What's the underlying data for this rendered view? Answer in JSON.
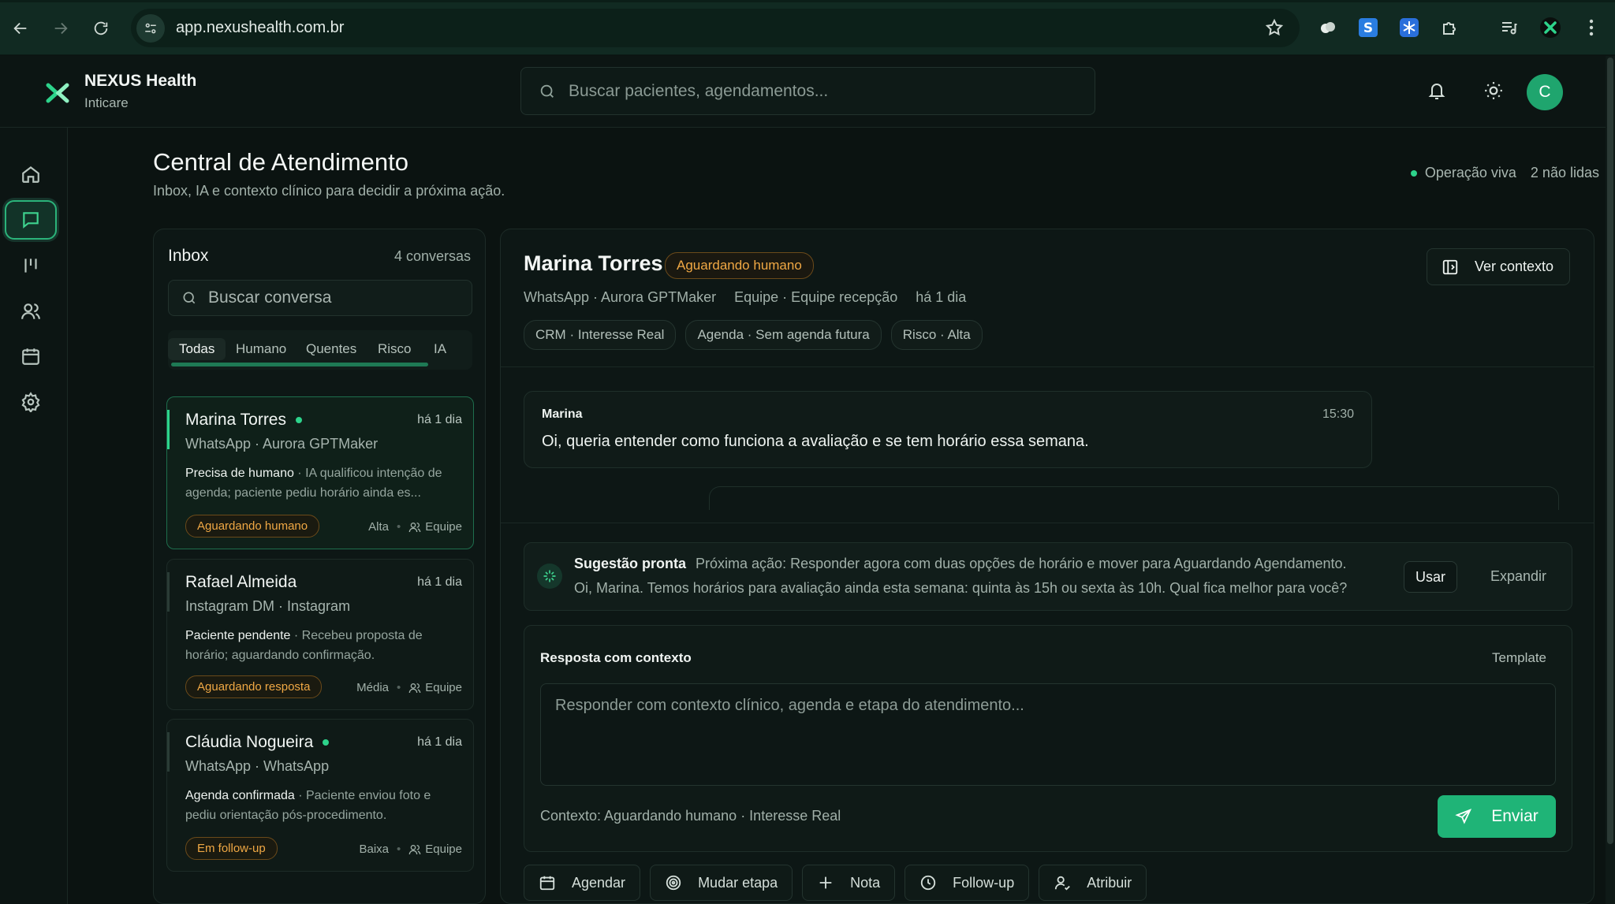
{
  "browser": {
    "url": "app.nexushealth.com.br"
  },
  "brand": {
    "name": "NEXUS Health",
    "subtitle": "Inticare",
    "accent": "#2dd38b"
  },
  "header": {
    "search_placeholder": "Buscar pacientes, agendamentos...",
    "avatar_initial": "C"
  },
  "sidebar": {
    "items": [
      {
        "icon": "home-icon"
      },
      {
        "icon": "chat-icon",
        "active": true
      },
      {
        "icon": "pipeline-icon"
      },
      {
        "icon": "users-icon"
      },
      {
        "icon": "calendar-icon"
      },
      {
        "icon": "settings-icon"
      }
    ]
  },
  "page": {
    "title": "Central de Atendimento",
    "subtitle": "Inbox, IA e contexto clínico para decidir a próxima ação.",
    "live_status": "Operação viva",
    "unread": "2 não lidas"
  },
  "inbox": {
    "title": "Inbox",
    "count": "4 conversas",
    "search_placeholder": "Buscar conversa",
    "filters": [
      "Todas",
      "Humano",
      "Quentes",
      "Risco",
      "IA"
    ],
    "active_filter": "Todas",
    "conversations": [
      {
        "name": "Marina Torres",
        "online": true,
        "time": "há 1 dia",
        "channel": "WhatsApp · Aurora GPTMaker",
        "preview_strong": "Precisa de humano",
        "preview_text": " · IA qualificou intenção de agenda; paciente pediu horário ainda es...",
        "tag": "Aguardando humano",
        "priority": "Alta",
        "team": "Equipe"
      },
      {
        "name": "Rafael Almeida",
        "online": false,
        "time": "há 1 dia",
        "channel": "Instagram DM · Instagram",
        "preview_strong": "Paciente pendente",
        "preview_text": " · Recebeu proposta de horário; aguardando confirmação.",
        "tag": "Aguardando resposta",
        "priority": "Média",
        "team": "Equipe"
      },
      {
        "name": "Cláudia Nogueira",
        "online": true,
        "time": "há 1 dia",
        "channel": "WhatsApp · WhatsApp",
        "preview_strong": "Agenda confirmada",
        "preview_text": " · Paciente enviou foto e pediu orientação pós-procedimento.",
        "tag": "Em follow-up",
        "priority": "Baixa",
        "team": "Equipe"
      }
    ]
  },
  "conversation": {
    "contact_name": "Marina Torres",
    "status": "Aguardando humano",
    "context_button": "Ver contexto",
    "meta": [
      "WhatsApp · Aurora GPTMaker",
      "Equipe · Equipe recepção",
      "há 1 dia"
    ],
    "chips": [
      "CRM · Interesse Real",
      "Agenda · Sem agenda futura",
      "Risco · Alta"
    ],
    "messages": [
      {
        "sender": "Marina",
        "time": "15:30",
        "text": "Oi, queria entender como funciona a avaliação e se tem horário essa semana."
      }
    ],
    "suggestion": {
      "title": "Sugestão pronta",
      "next_action": "Próxima ação: Responder agora com duas opções de horário e mover para Aguardando Agendamento.",
      "draft": "Oi, Marina. Temos horários para avaliação ainda esta semana: quinta às 15h ou sexta às 10h. Qual fica melhor para você?",
      "use_label": "Usar",
      "expand_label": "Expandir"
    },
    "composer": {
      "title": "Resposta com contexto",
      "template_label": "Template",
      "placeholder": "Responder com contexto clínico, agenda e etapa do atendimento...",
      "context": "Contexto: Aguardando humano · Interesse Real",
      "send_label": "Enviar"
    },
    "actions": [
      {
        "label": "Agendar",
        "icon": "calendar-icon"
      },
      {
        "label": "Mudar etapa",
        "icon": "target-icon"
      },
      {
        "label": "Nota",
        "icon": "plus-icon"
      },
      {
        "label": "Follow-up",
        "icon": "clock-icon"
      },
      {
        "label": "Atribuir",
        "icon": "user-assign-icon"
      }
    ]
  }
}
